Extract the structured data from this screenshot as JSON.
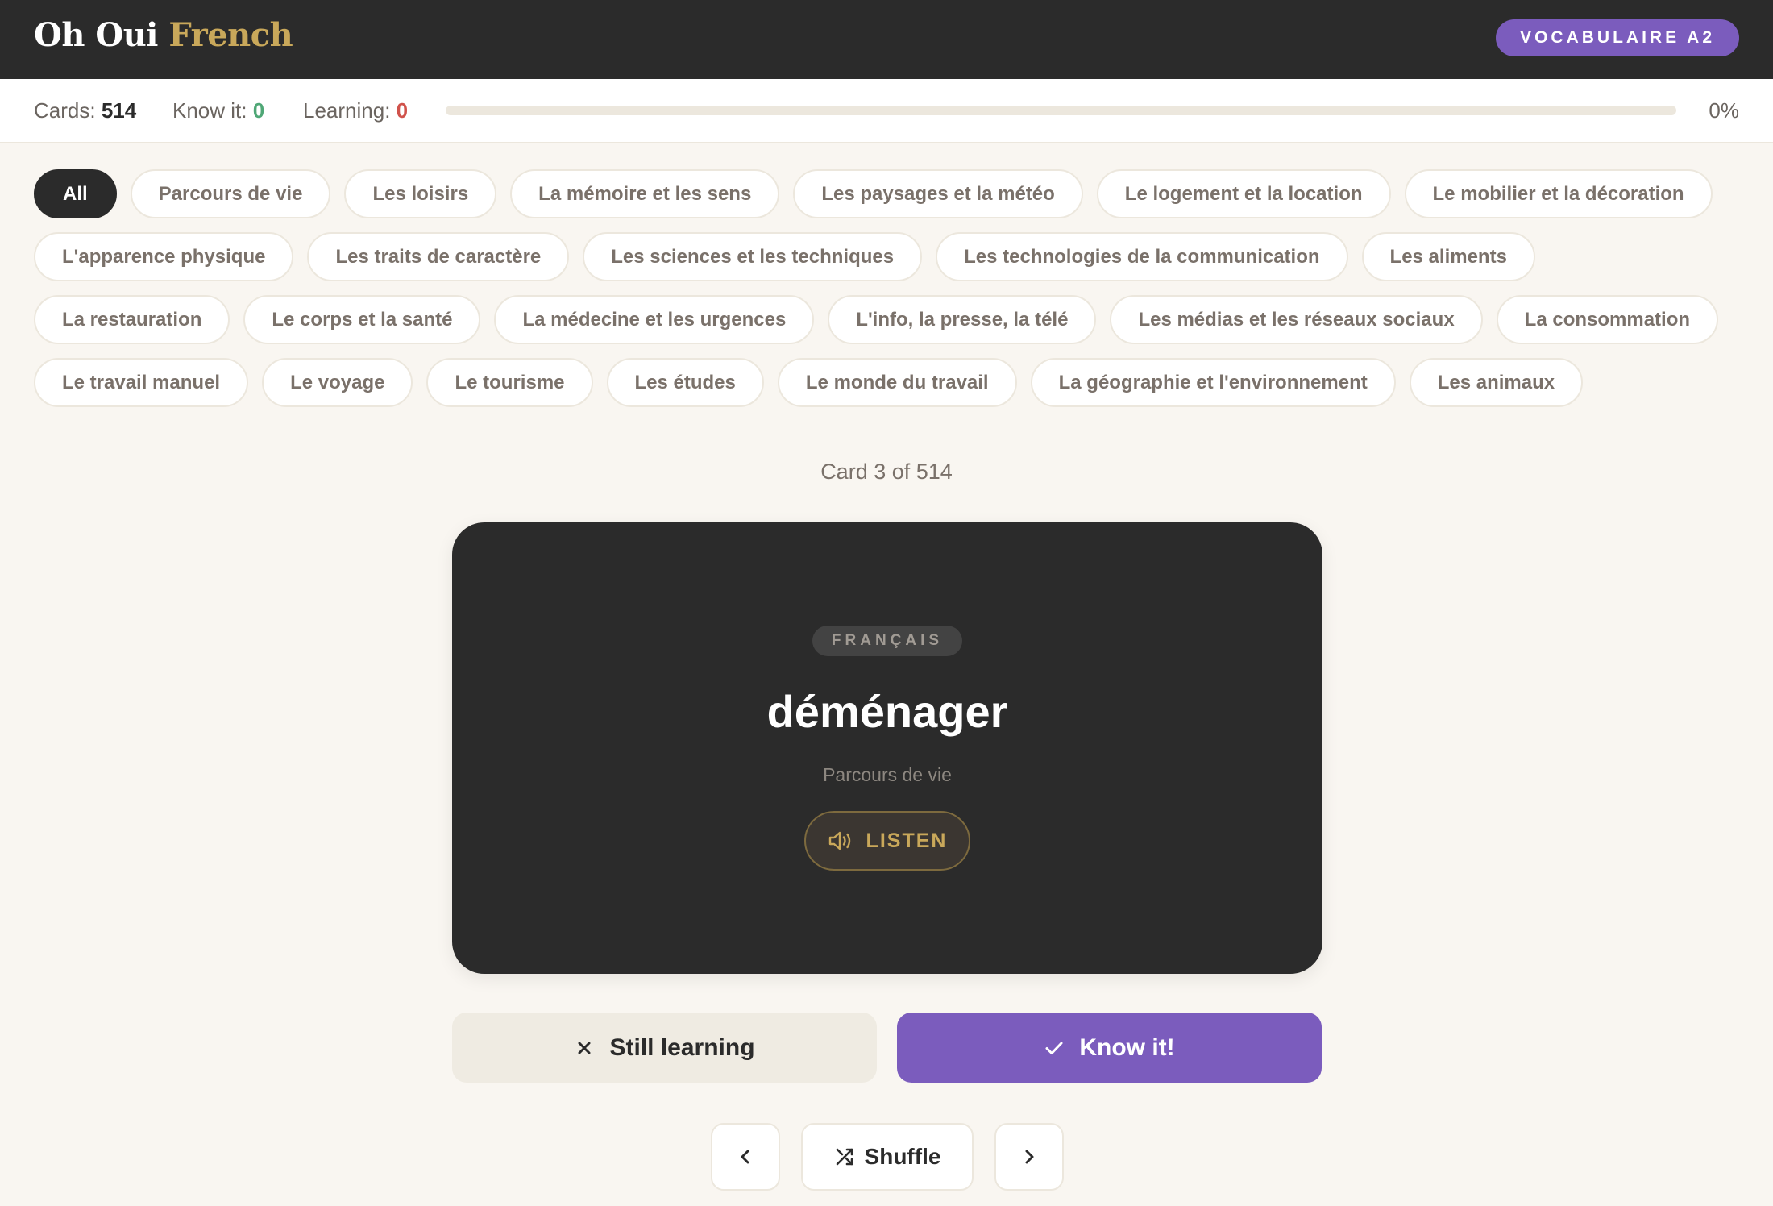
{
  "header": {
    "logo_primary": "Oh Oui",
    "logo_accent": "French",
    "level_badge": "VOCABULAIRE A2"
  },
  "stats": {
    "cards_label": "Cards:",
    "cards_value": "514",
    "know_label": "Know it:",
    "know_value": "0",
    "learning_label": "Learning:",
    "learning_value": "0",
    "progress_percent": "0%",
    "progress_fraction": 0
  },
  "categories": [
    "All",
    "Parcours de vie",
    "Les loisirs",
    "La mémoire et les sens",
    "Les paysages et la météo",
    "Le logement et la location",
    "Le mobilier et la décoration",
    "L'apparence physique",
    "Les traits de caractère",
    "Les sciences et les techniques",
    "Les technologies de la communication",
    "Les aliments",
    "La restauration",
    "Le corps et la santé",
    "La médecine et les urgences",
    "L'info, la presse, la télé",
    "Les médias et les réseaux sociaux",
    "La consommation",
    "Le travail manuel",
    "Le voyage",
    "Le tourisme",
    "Les études",
    "Le monde du travail",
    "La géographie et l'environnement",
    "Les animaux"
  ],
  "active_category": "All",
  "card_counter": "Card 3 of 514",
  "flashcard": {
    "language_tag": "FRANÇAIS",
    "word": "déménager",
    "category": "Parcours de vie",
    "listen_label": "LISTEN",
    "listen_icon": "speaker-icon"
  },
  "actions": {
    "still_learning_label": "Still learning",
    "still_learning_icon": "x-icon",
    "know_it_label": "Know it!",
    "know_it_icon": "check-icon"
  },
  "navigation": {
    "prev_icon": "chevron-left-icon",
    "shuffle_label": "Shuffle",
    "shuffle_icon": "shuffle-icon",
    "next_icon": "chevron-right-icon"
  },
  "colors": {
    "header_bg": "#2b2b2b",
    "accent_gold": "#c9a85a",
    "accent_purple": "#7b5cbd",
    "know_green": "#4fa776",
    "learning_red": "#d0524b",
    "page_bg": "#f9f6f1"
  }
}
